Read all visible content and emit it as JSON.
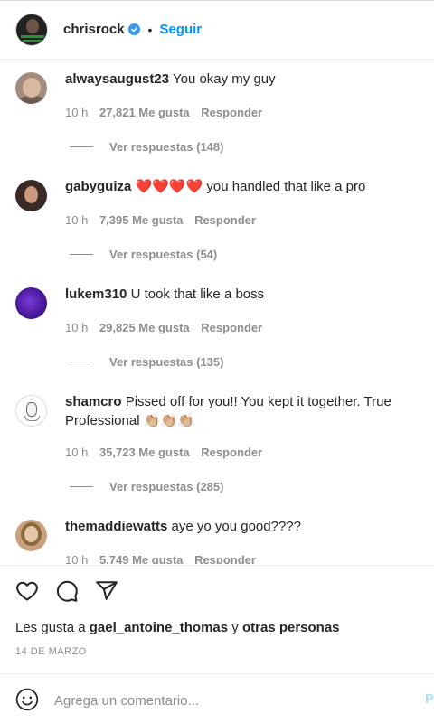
{
  "header": {
    "username": "chrisrock",
    "separator": "•",
    "follow_label": "Seguir"
  },
  "comments": [
    {
      "user": "alwaysaugust23",
      "text": "You okay my guy",
      "time": "10 h",
      "likes": "27,821 Me gusta",
      "reply": "Responder",
      "replies": "Ver respuestas (148)"
    },
    {
      "user": "gabyguiza",
      "text": "❤️❤️❤️❤️ you handled that like a pro",
      "time": "10 h",
      "likes": "7,395 Me gusta",
      "reply": "Responder",
      "replies": "Ver respuestas (54)"
    },
    {
      "user": "lukem310",
      "text": "U took that like a boss",
      "time": "10 h",
      "likes": "29,825 Me gusta",
      "reply": "Responder",
      "replies": "Ver respuestas (135)"
    },
    {
      "user": "shamcro",
      "text": "Pissed off for you!! You kept it together. True Professional 👏🏼👏🏼👏🏼",
      "time": "10 h",
      "likes": "35,723 Me gusta",
      "reply": "Responder",
      "replies": "Ver respuestas (285)"
    },
    {
      "user": "themaddiewatts",
      "text": "aye yo you good????",
      "time": "10 h",
      "likes": "5,749 Me gusta",
      "reply": "Responder"
    }
  ],
  "actions": {
    "icons": [
      "heart-icon",
      "comment-icon",
      "share-icon"
    ]
  },
  "likes_line": {
    "prefix": "Les gusta a",
    "user": "gael_antoine_thomas",
    "connector": "y",
    "others": "otras personas"
  },
  "date": "14 DE MARZO",
  "add_comment": {
    "placeholder": "Agrega un comentario...",
    "post_label": "P"
  }
}
